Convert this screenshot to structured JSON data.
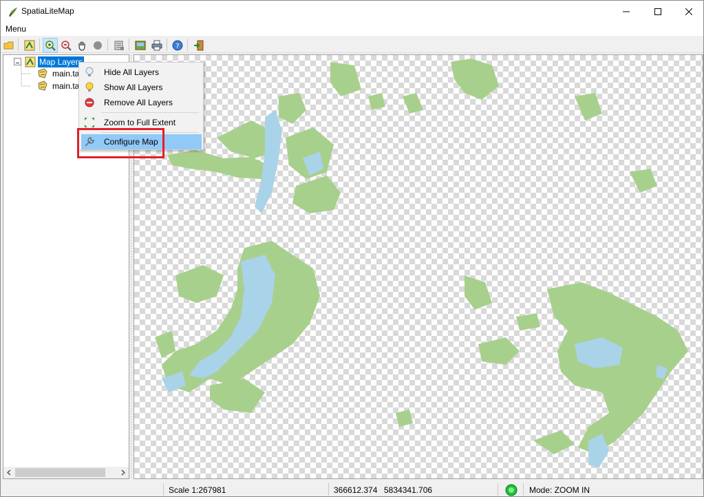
{
  "window": {
    "title": "SpatiaLiteMap",
    "controls": [
      "minimize",
      "maximize",
      "close"
    ]
  },
  "menubar": {
    "menu_label": "Menu"
  },
  "toolbar": {
    "buttons": [
      "open-icon",
      "layer-icon",
      "zoom-in-icon",
      "zoom-out-icon",
      "pan-icon",
      "identify-icon",
      "table-icon",
      "image-icon",
      "print-icon",
      "help-icon",
      "exit-icon"
    ],
    "active": "zoom-in-icon"
  },
  "tree": {
    "root_label": "Map Layers",
    "children": [
      {
        "label": "main.ta"
      },
      {
        "label": "main.ta"
      }
    ],
    "collapse_glyph": "⊟"
  },
  "context_menu": {
    "items": [
      {
        "label": "Hide All Layers",
        "icon": "bulb-off-icon"
      },
      {
        "label": "Show All Layers",
        "icon": "bulb-on-icon"
      },
      {
        "label": "Remove All Layers",
        "icon": "remove-icon"
      },
      {
        "label": "Zoom to Full Extent",
        "icon": "full-extent-icon"
      },
      {
        "label": "Configure Map",
        "icon": "wrench-icon",
        "highlighted": true
      }
    ]
  },
  "statusbar": {
    "scale": "Scale 1:267981",
    "x_coord": "366612.374",
    "y_coord": "5834341.706",
    "mode": "Mode: ZOOM IN"
  },
  "colors": {
    "land": "#a8d08d",
    "water": "#a9d3e8",
    "highlight": "#91c9f7",
    "annotation": "#e0202a"
  }
}
